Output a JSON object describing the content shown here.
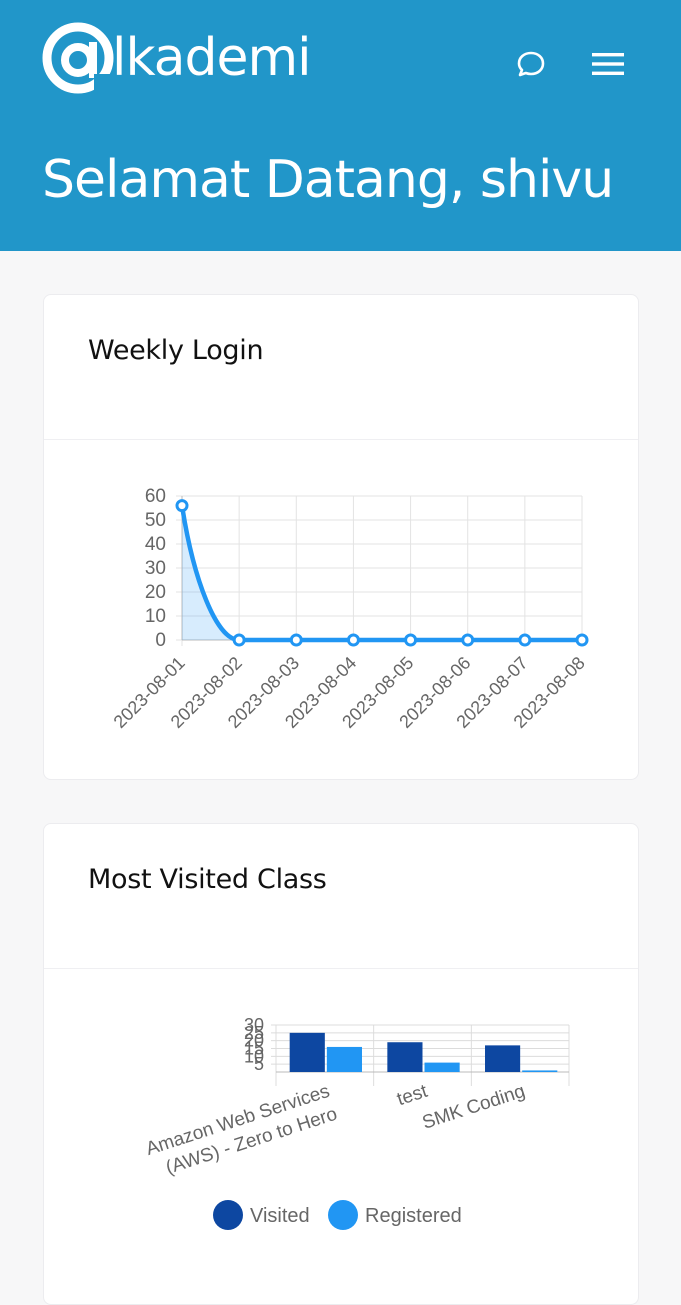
{
  "app": {
    "logo_text": "lkademi",
    "welcome": "Selamat Datang, shivu"
  },
  "icons": {
    "chat": "chat-bubble-icon",
    "menu": "hamburger-menu-icon"
  },
  "colors": {
    "header": "#2196c9",
    "line": "#2196f3",
    "visited": "#0d47a1",
    "registered": "#2196f3"
  },
  "cards": {
    "weekly_title": "Weekly Login",
    "visited_title": "Most Visited Class"
  },
  "chart_data": [
    {
      "type": "line",
      "title": "Weekly Login",
      "x": [
        "2023-08-01",
        "2023-08-02",
        "2023-08-03",
        "2023-08-04",
        "2023-08-05",
        "2023-08-06",
        "2023-08-07",
        "2023-08-08"
      ],
      "series": [
        {
          "values": [
            56,
            0,
            0,
            0,
            0,
            0,
            0,
            0
          ]
        }
      ],
      "yticks": [
        0,
        10,
        20,
        30,
        40,
        50,
        60
      ],
      "ylim": [
        0,
        60
      ],
      "grid": true,
      "fill": true
    },
    {
      "type": "bar",
      "title": "Most Visited Class",
      "categories": [
        [
          "Amazon Web Services",
          "(AWS) - Zero to Hero"
        ],
        [
          "test"
        ],
        [
          "SMK Coding"
        ]
      ],
      "series": [
        {
          "name": "Visited",
          "values": [
            25,
            19,
            17
          ]
        },
        {
          "name": "Registered",
          "values": [
            16,
            6,
            1
          ]
        }
      ],
      "yticks": [
        5,
        10,
        15,
        20,
        25,
        30
      ],
      "ylim": [
        0,
        30
      ],
      "grid": true,
      "legend": "bottom"
    }
  ]
}
